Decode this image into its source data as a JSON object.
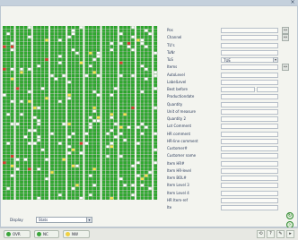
{
  "window": {
    "close_glyph": "×"
  },
  "grid": {
    "colors": {
      "ok": "#2faa2f",
      "warn": "#f2e44a",
      "error": "#d93a2a",
      "empty": "#ffffff"
    }
  },
  "form": {
    "fields": [
      {
        "label": "Pos",
        "value": ""
      },
      {
        "label": "Channel",
        "value": ""
      },
      {
        "label": "TU's",
        "value": ""
      },
      {
        "label": "TuNr",
        "value": ""
      },
      {
        "label": "TuS",
        "value": "TUE"
      },
      {
        "label": "Items",
        "value": ""
      },
      {
        "label": "AutoLevel",
        "value": ""
      },
      {
        "label": "LabelLevel",
        "value": ""
      },
      {
        "label": "Best before",
        "value": ""
      },
      {
        "label": "Productiondate",
        "value": ""
      },
      {
        "label": "Quantity",
        "value": ""
      },
      {
        "label": "Unit of measure",
        "value": ""
      },
      {
        "label": "Quantity 2",
        "value": ""
      },
      {
        "label": "Lot Comment",
        "value": ""
      },
      {
        "label": "HR comment",
        "value": ""
      },
      {
        "label": "HR-line comment",
        "value": ""
      },
      {
        "label": "Customer#",
        "value": ""
      },
      {
        "label": "Customer name",
        "value": ""
      },
      {
        "label": "Item HR#",
        "value": ""
      },
      {
        "label": "Item HR-level",
        "value": ""
      },
      {
        "label": "Item BOL#",
        "value": ""
      },
      {
        "label": "Item Level 3",
        "value": ""
      },
      {
        "label": "Item Level 4",
        "value": ""
      },
      {
        "label": "HR Item-ref",
        "value": ""
      },
      {
        "label": "Ite",
        "value": ""
      }
    ]
  },
  "display": {
    "label": "Display",
    "selected": "Stats",
    "arrow": "▾"
  },
  "statusbar": {
    "buttons": [
      {
        "label": "OVR",
        "color": "#3aa53a"
      },
      {
        "label": "NC",
        "color": "#3aa53a"
      },
      {
        "label": "NW",
        "color": "#f0d040"
      }
    ],
    "tools": [
      "⟲",
      "?",
      "✎",
      "▸"
    ]
  }
}
